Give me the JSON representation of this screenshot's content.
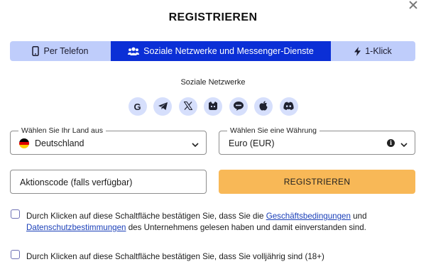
{
  "title": "REGISTRIEREN",
  "tabs": [
    {
      "label": "Per Telefon",
      "icon": "phone-icon"
    },
    {
      "label": "Soziale Netzwerke und Messenger-Dienste",
      "icon": "users-icon",
      "active": true
    },
    {
      "label": "1-Klick",
      "icon": "lightning-icon"
    }
  ],
  "social": {
    "label": "Soziale Netzwerke",
    "buttons": [
      {
        "icon": "google-icon",
        "glyph": "G"
      },
      {
        "icon": "telegram-icon"
      },
      {
        "icon": "x-icon",
        "glyph": "𝕏"
      },
      {
        "icon": "mailru-icon"
      },
      {
        "icon": "line-icon"
      },
      {
        "icon": "apple-icon"
      },
      {
        "icon": "discord-icon"
      }
    ]
  },
  "country": {
    "label": "Wählen Sie Ihr Land aus",
    "value": "Deutschland",
    "flag_colors": [
      "#000000",
      "#dd0000",
      "#ffce00"
    ]
  },
  "currency": {
    "label": "Wählen Sie eine Währung",
    "value": "Euro (EUR)"
  },
  "promo": {
    "placeholder": "Aktionscode (falls verfügbar)"
  },
  "register_button": "REGISTRIEREN",
  "consent1": {
    "text_before": "Durch Klicken auf diese Schaltfläche bestätigen Sie, dass Sie die ",
    "link1": "Geschäftsbedingungen",
    "text_middle": " und ",
    "link2": "Datenschutzbestimmungen",
    "text_after": " des Unternehmens gelesen haben und damit einverstanden sind."
  },
  "consent2": {
    "text": "Durch Klicken auf diese Schaltfläche bestätigen Sie, dass Sie volljährig sind (18+)"
  },
  "colors": {
    "accent": "#0b2fd6",
    "tab_bg": "#bfcdfb",
    "button": "#f8b857",
    "social_bg": "#d6dffc",
    "link": "#1a3fb8"
  }
}
